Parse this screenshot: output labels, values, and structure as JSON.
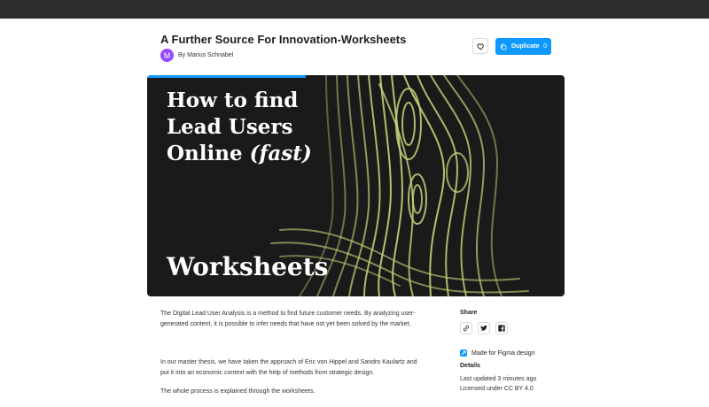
{
  "page": {
    "title": "A Further Source For Innovation-Worksheets",
    "author": {
      "initial": "M",
      "byline": "By Marius Schnabel"
    }
  },
  "actions": {
    "like_icon": "heart-icon",
    "duplicate_label": "Duplicate",
    "duplicate_count": "0",
    "duplicate_icon": "duplicate-icon"
  },
  "hero": {
    "heading_line1": "How to find",
    "heading_line2": "Lead Users",
    "heading_line3": "Online",
    "heading_line3_italic": "(fast)",
    "footer": "Worksheets",
    "carousel_progress": 0.38,
    "colors": {
      "background": "#1a1a1a",
      "accent": "#c8d37a",
      "progress": "#0d99ff"
    }
  },
  "description": {
    "p1": "The Digital Lead User Analysis is a method to find future customer needs. By analyzing user-generated content, it is possible to infer needs that have not yet been solved by the market.",
    "p2": "In our master thesis, we have taken the approach of Eric von Hippel and Sandro Kaulartz and put it into an economic context with the help of methods from strategic design.",
    "p3": "The whole process is explained through the worksheets."
  },
  "sidebar": {
    "share_title": "Share",
    "share_icons": [
      "link-icon",
      "twitter-icon",
      "facebook-icon"
    ],
    "made_for": "Made for Figma design",
    "details_title": "Details",
    "updated": "Last updated 3 minutes ago",
    "license": "Licensed under CC BY 4.0"
  },
  "colors": {
    "accent": "#0d99ff",
    "avatar": "#9747ff",
    "topbar": "#2c2c2c"
  }
}
